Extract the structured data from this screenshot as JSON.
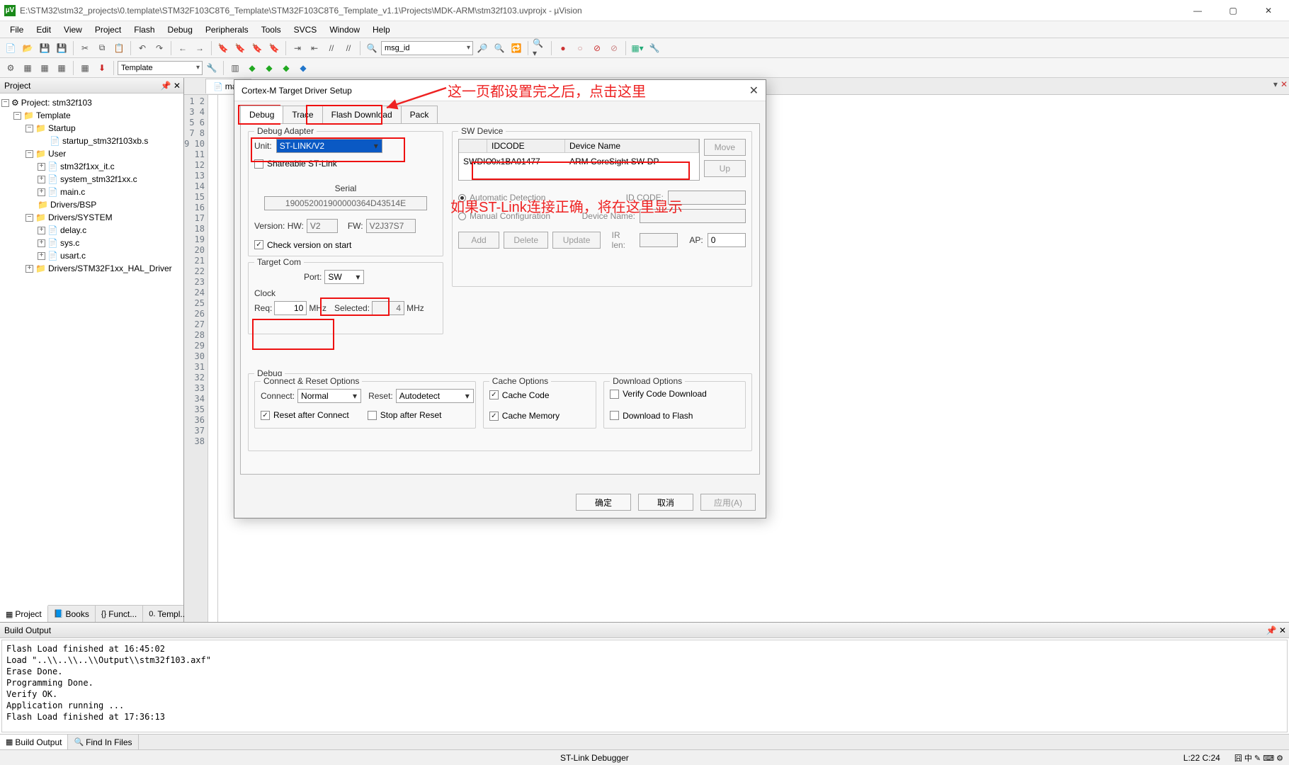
{
  "title": "E:\\STM32\\stm32_projects\\0.template\\STM32F103C8T6_Template\\STM32F103C8T6_Template_v1.1\\Projects\\MDK-ARM\\stm32f103.uvprojx - µVision",
  "menubar": [
    "File",
    "Edit",
    "View",
    "Project",
    "Flash",
    "Debug",
    "Peripherals",
    "Tools",
    "SVCS",
    "Window",
    "Help"
  ],
  "toolbar": {
    "target_combo": "Template",
    "search_combo": "msg_id"
  },
  "project_panel": {
    "title": "Project",
    "root": "Project: stm32f103",
    "template": "Template",
    "folders": {
      "startup": "Startup",
      "user": "User",
      "bsp": "Drivers/BSP",
      "system": "Drivers/SYSTEM",
      "hal": "Drivers/STM32F1xx_HAL_Driver"
    },
    "files": {
      "startup": "startup_stm32f103xb.s",
      "it": "stm32f1xx_it.c",
      "sys": "system_stm32f1xx.c",
      "main": "main.c",
      "delay": "delay.c",
      "sysc": "sys.c",
      "usart": "usart.c"
    },
    "tabs": [
      "Project",
      "Books",
      "Funct...",
      "Templ..."
    ]
  },
  "editor": {
    "tab": "main",
    "line_start": 1,
    "line_end": 38
  },
  "dialog": {
    "title": "Cortex-M Target Driver Setup",
    "tabs": [
      "Debug",
      "Trace",
      "Flash Download",
      "Pack"
    ],
    "debug_adapter": {
      "label": "Debug Adapter",
      "unit_label": "Unit:",
      "unit_value": "ST-LINK/V2",
      "shareable": "Shareable ST-Link",
      "serial_label": "Serial",
      "serial_value": "190052001900000364D43514E",
      "version_label": "Version: HW:",
      "hw": "V2",
      "fw_label": "FW:",
      "fw": "V2J37S7",
      "check_ver": "Check version on start"
    },
    "target_com": {
      "label": "Target Com",
      "port_label": "Port:",
      "port_value": "SW",
      "clock_label": "Clock",
      "req_label": "Req:",
      "req_value": "10",
      "req_unit": "MHz",
      "sel_label": "Selected:",
      "sel_value": "4",
      "sel_unit": "MHz"
    },
    "sw_device": {
      "label": "SW Device",
      "col_idcode": "IDCODE",
      "col_devname": "Device Name",
      "row_port": "SWDIO",
      "row_idcode": "0x1BA01477",
      "row_name": "ARM CoreSight SW-DP",
      "move": "Move",
      "up": "Up",
      "auto": "Automatic Detection",
      "manual": "Manual Configuration",
      "idcode": "ID CODE:",
      "devname": "Device Name:",
      "add": "Add",
      "delete": "Delete",
      "update": "Update",
      "irlen": "IR len:",
      "ap": "AP:",
      "ap_value": "0"
    },
    "debug_group": {
      "label": "Debug",
      "connect_reset": "Connect & Reset Options",
      "connect_label": "Connect:",
      "connect_value": "Normal",
      "reset_label": "Reset:",
      "reset_value": "Autodetect",
      "reset_after": "Reset after Connect",
      "stop_after": "Stop after Reset",
      "cache_opts": "Cache Options",
      "cache_code": "Cache Code",
      "cache_mem": "Cache Memory",
      "download_opts": "Download Options",
      "verify": "Verify Code Download",
      "dl_flash": "Download to Flash"
    },
    "buttons": {
      "ok": "确定",
      "cancel": "取消",
      "apply": "应用(A)"
    }
  },
  "annotations": {
    "top": "这一页都设置完之后，点击这里",
    "right": "如果ST-Link连接正确，将在这里显示"
  },
  "build_output": {
    "title": "Build Output",
    "lines": [
      "Flash Load finished at 16:45:02",
      "Load \"..\\\\..\\\\..\\\\Output\\\\stm32f103.axf\"",
      "Erase Done.",
      "Programming Done.",
      "Verify OK.",
      "Application running ...",
      "Flash Load finished at 17:36:13"
    ],
    "tabs": [
      "Build Output",
      "Find In Files"
    ]
  },
  "statusbar": {
    "debugger": "ST-Link Debugger",
    "pos": "L:22 C:24"
  }
}
